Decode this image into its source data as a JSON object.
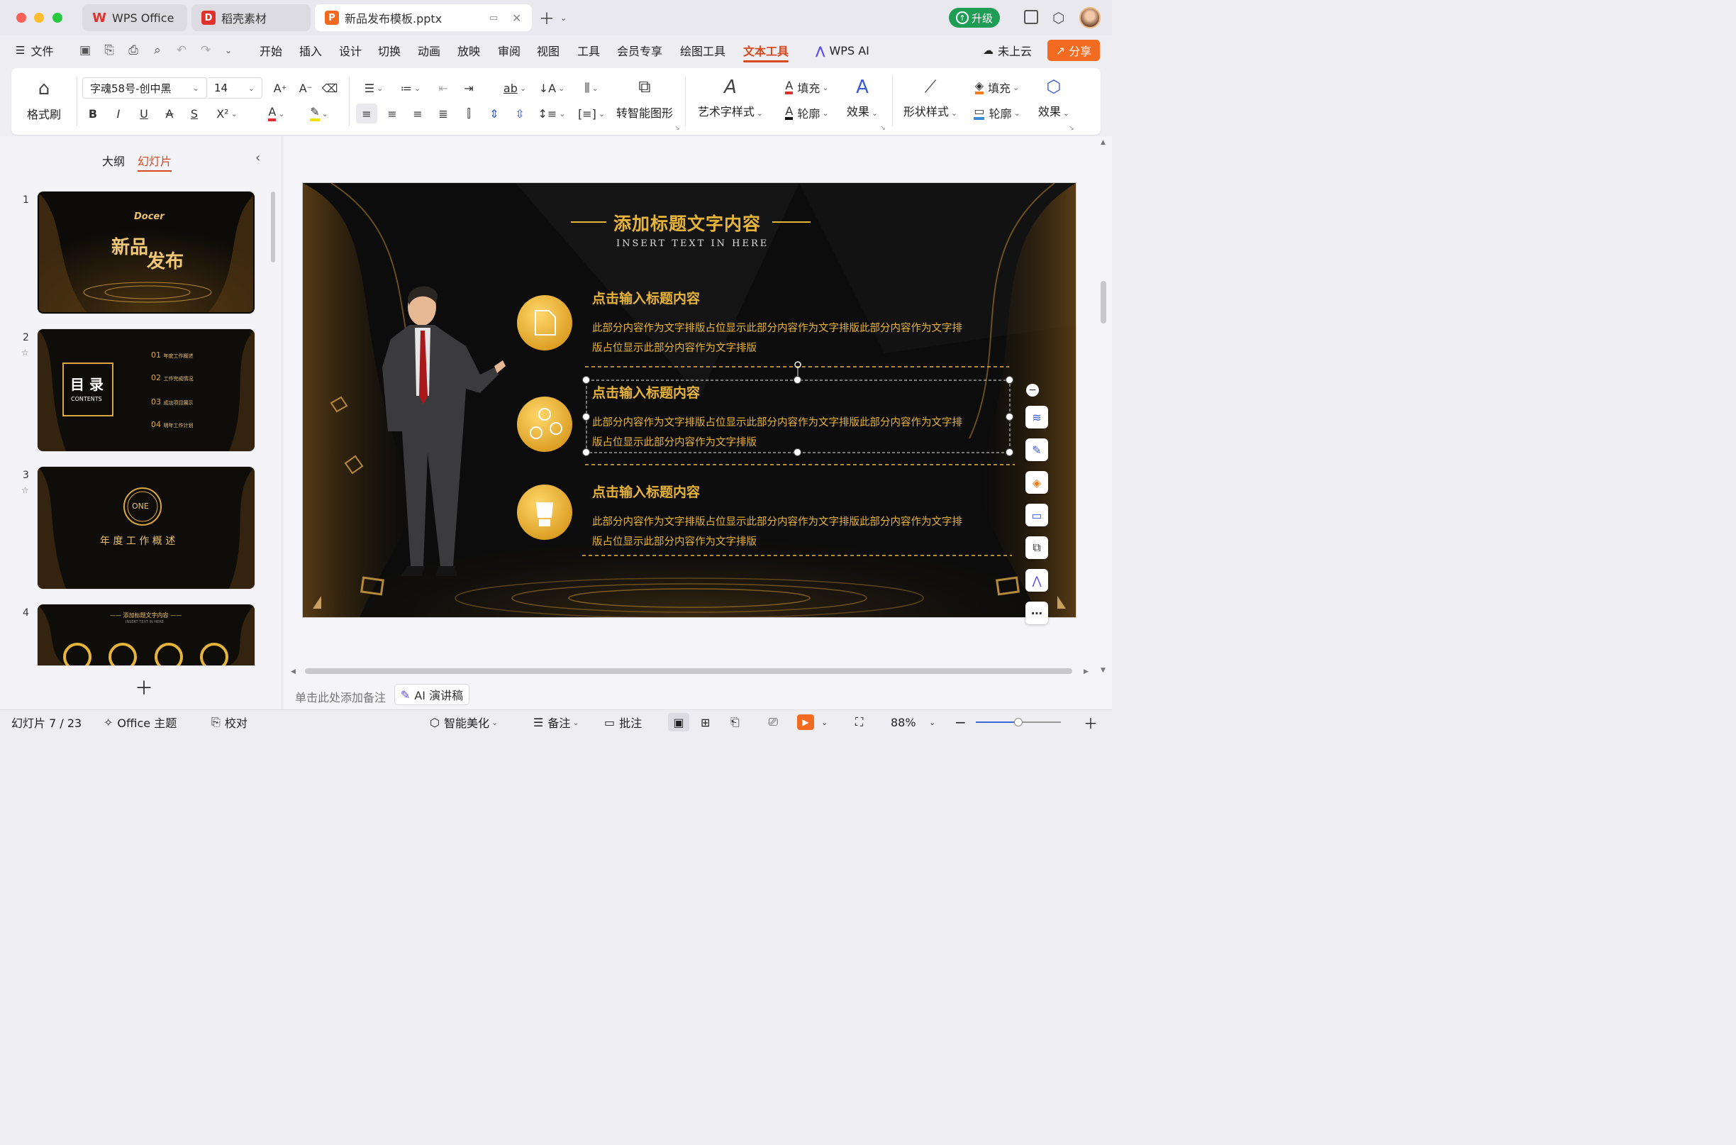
{
  "titlebar": {
    "tabs": [
      {
        "label": "WPS Office"
      },
      {
        "label": "稻壳素材"
      },
      {
        "label": "新品发布模板.pptx"
      }
    ],
    "upgrade_label": "升级"
  },
  "menubar": {
    "file_label": "文件",
    "items": [
      "开始",
      "插入",
      "设计",
      "切换",
      "动画",
      "放映",
      "审阅",
      "视图",
      "工具",
      "会员专享",
      "绘图工具",
      "文本工具"
    ],
    "wps_ai_label": "WPS AI",
    "cloud_label": "未上云",
    "share_label": "分享"
  },
  "ribbon": {
    "format_painter_label": "格式刷",
    "font_name": "字魂58号-创中黑",
    "font_size": "14",
    "smart_shape_label": "转智能图形",
    "art_style_label": "艺术字样式",
    "fill_label": "填充",
    "outline_label": "轮廓",
    "effect_label": "效果",
    "shape_style_label": "形状样式",
    "shape_fill_label": "填充",
    "shape_outline_label": "轮廓",
    "shape_effect_label": "效果"
  },
  "leftpanel": {
    "tab_outline": "大纲",
    "tab_slides": "幻灯片",
    "thumbs": [
      {
        "num": "1",
        "brand": "Docer",
        "title_a": "新品",
        "title_b": "发布"
      },
      {
        "num": "2",
        "toc_title": "目 录",
        "toc_sub": "CONTENTS",
        "items": [
          {
            "n": "01",
            "t": "年度工作概述"
          },
          {
            "n": "02",
            "t": "工作完成情况"
          },
          {
            "n": "03",
            "t": "成功项目展示"
          },
          {
            "n": "04",
            "t": "明年工作计划"
          }
        ]
      },
      {
        "num": "3",
        "circle": "ONE",
        "title": "年 度 工 作 概 述"
      },
      {
        "num": "4",
        "title": "—— 添加标题文字内容 ——",
        "sub": "INSERT TEXT IN HERE"
      }
    ]
  },
  "slide": {
    "title": "添加标题文字内容",
    "subtitle": "INSERT TEXT IN HERE",
    "items": [
      {
        "heading": "点击输入标题内容",
        "line1": "此部分内容作为文字排版占位显示此部分内容作为文字排版此部分内容作为文字排",
        "line2": "版占位显示此部分内容作为文字排版"
      },
      {
        "heading": "点击输入标题内容",
        "line1": "此部分内容作为文字排版占位显示此部分内容作为文字排版此部分内容作为文字排",
        "line2": "版占位显示此部分内容作为文字排版"
      },
      {
        "heading": "点击输入标题内容",
        "line1": "此部分内容作为文字排版占位显示此部分内容作为文字排版此部分内容作为文字排",
        "line2": "版占位显示此部分内容作为文字排版"
      }
    ]
  },
  "notes": {
    "placeholder": "单击此处添加备注",
    "ai_label": "AI 演讲稿"
  },
  "statusbar": {
    "slide_info": "幻灯片 7 / 23",
    "theme_label": "Office 主题",
    "proof_label": "校对",
    "beautify_label": "智能美化",
    "notes_label": "备注",
    "comment_label": "批注",
    "zoom": "88%"
  },
  "colors": {
    "accent": "#d8481f",
    "gold": "#e7b43a",
    "upgrade": "#1f9d55"
  }
}
